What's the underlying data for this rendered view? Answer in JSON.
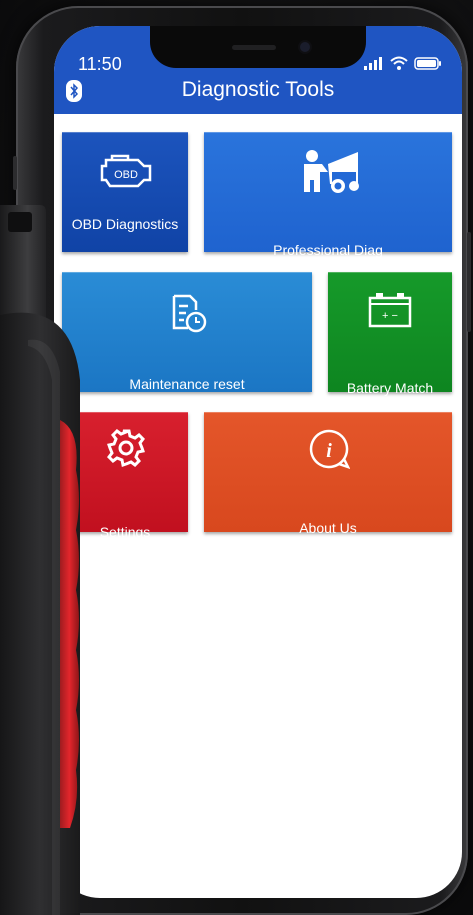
{
  "status_bar": {
    "time": "11:50"
  },
  "header": {
    "title": "Diagnostic Tools",
    "icon": "bluetooth-icon"
  },
  "tiles": [
    {
      "label": "OBD Diagnostics",
      "icon": "engine-obd-icon",
      "color": "#1043a6"
    },
    {
      "label": "Professional Diag",
      "icon": "mechanic-car-icon",
      "color": "#1f63cf"
    },
    {
      "label": "Maintenance reset",
      "icon": "service-clock-icon",
      "color": "#1b76c4"
    },
    {
      "label": "Battery Match",
      "icon": "battery-icon",
      "color": "#0e8520"
    },
    {
      "label": "Settings",
      "icon": "gear-icon",
      "color": "#c1101f"
    },
    {
      "label": "About Us",
      "icon": "info-icon",
      "color": "#d8481e"
    }
  ],
  "engine_icon_text": "OBD",
  "battery_icon_text": "+ −"
}
